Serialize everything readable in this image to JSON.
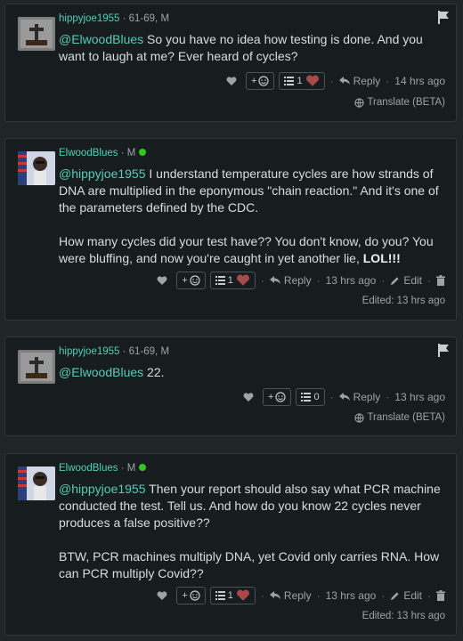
{
  "comments": [
    {
      "username": "hippyjoe1955",
      "meta": " · 61-69, M",
      "online": false,
      "mention": "@ElwoodBlues",
      "paragraphs": [
        " So you have no idea how testing is done. And you want to laugh at me? Ever heard of cycles?"
      ],
      "react_label": "+",
      "list_count": "1",
      "reply": "Reply",
      "time": "14 hrs ago",
      "edit": "",
      "footer": "Translate (BETA)"
    },
    {
      "username": "ElwoodBlues",
      "meta": " · M",
      "online": true,
      "mention": "@hippyjoe1955",
      "paragraphs": [
        " I understand temperature cycles are how strands of DNA are multiplied in the eponymous \"chain reaction.\" And it's one of the parameters defined by the CDC.",
        "How many cycles did your test have?? You don't know, do you? You were bluffing, and now you're caught in yet another lie, "
      ],
      "bold_tail": "LOL!!!",
      "react_label": "+",
      "list_count": "1",
      "reply": "Reply",
      "time": "13 hrs ago",
      "edit": "Edit",
      "footer": "Edited: 13 hrs ago"
    },
    {
      "username": "hippyjoe1955",
      "meta": " · 61-69, M",
      "online": false,
      "mention": "@ElwoodBlues",
      "paragraphs": [
        " 22."
      ],
      "react_label": "+",
      "list_count": "0",
      "reply": "Reply",
      "time": "13 hrs ago",
      "edit": "",
      "footer": "Translate (BETA)"
    },
    {
      "username": "ElwoodBlues",
      "meta": " · M",
      "online": true,
      "mention": "@hippyjoe1955",
      "paragraphs": [
        " Then your report should also say what PCR machine conducted the test. Tell us. And how do you know 22 cycles never produces a false positive??",
        "BTW, PCR machines multiply DNA, yet Covid only carries RNA. How can PCR multiply Covid??"
      ],
      "react_label": "+",
      "list_count": "1",
      "reply": "Reply",
      "time": "13 hrs ago",
      "edit": "Edit",
      "footer": "Edited: 13 hrs ago"
    }
  ],
  "colors": {
    "username": "#4fd1b7",
    "mention": "#56cdb7",
    "online": "#34c51f",
    "heart": "#a94a4a"
  },
  "icons": [
    "flag-icon",
    "heart-icon",
    "smiley-icon",
    "list-icon",
    "reply-icon",
    "pencil-icon",
    "trash-icon",
    "globe-icon"
  ]
}
